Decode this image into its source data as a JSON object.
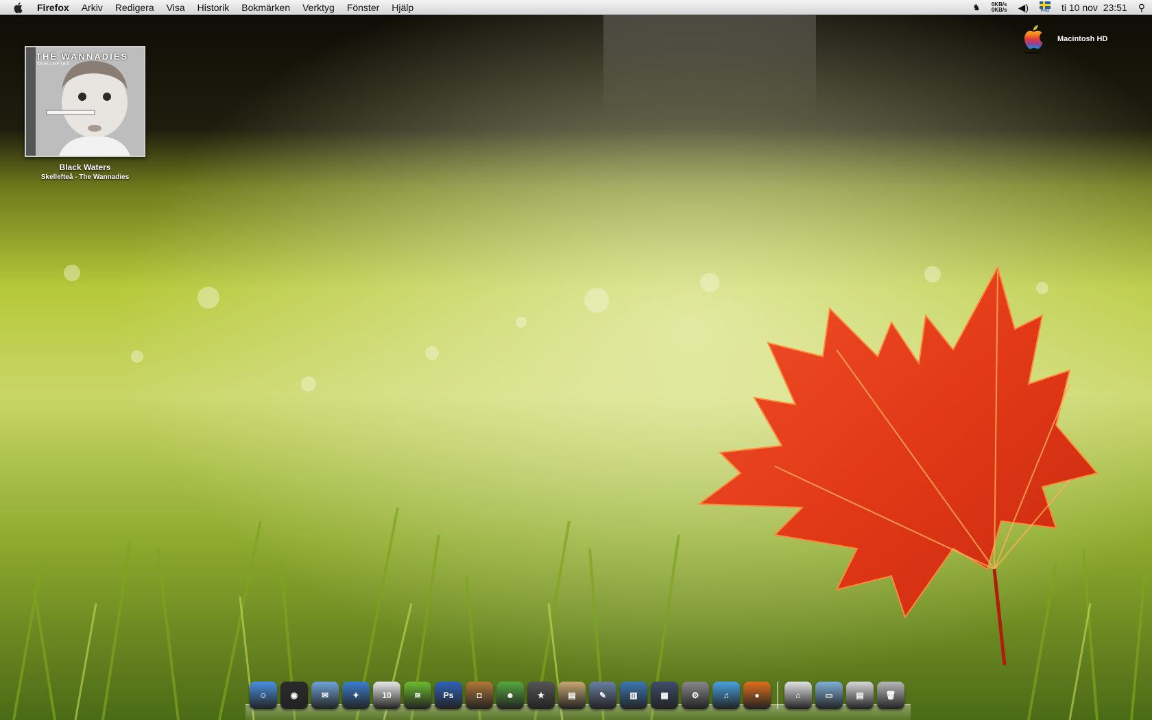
{
  "menubar": {
    "app_name": "Firefox",
    "items": [
      "Arkiv",
      "Redigera",
      "Visa",
      "Historik",
      "Bokmärken",
      "Verktyg",
      "Fönster",
      "Hjälp"
    ],
    "net_up": "0KB/s",
    "net_down": "0KB/s",
    "flag_label": "PRO",
    "datetime": "ti 10 nov  23:51"
  },
  "desktop": {
    "album": {
      "cover_title": "THE WANNADIES",
      "cover_subtitle": "SKELLEFTEÅ",
      "title": "Black Waters",
      "subtitle": "Skellefteå - The Wannadies"
    },
    "drive": {
      "label": "Macintosh HD"
    }
  },
  "dock": {
    "apps": [
      {
        "name": "finder-icon",
        "color": "#4a90e2",
        "glyph": "☺"
      },
      {
        "name": "dashboard-icon",
        "color": "#2b2b2b",
        "glyph": "◉"
      },
      {
        "name": "mail-icon",
        "color": "#6fa4d8",
        "glyph": "✉"
      },
      {
        "name": "safari-icon",
        "color": "#3a7fd0",
        "glyph": "✦"
      },
      {
        "name": "calendar-icon",
        "color": "#e9e9e9",
        "glyph": "10"
      },
      {
        "name": "spotify-icon",
        "color": "#6dbb2f",
        "glyph": "≋"
      },
      {
        "name": "photoshop-icon",
        "color": "#2f63b8",
        "glyph": "Ps"
      },
      {
        "name": "iphoto-icon",
        "color": "#b07838",
        "glyph": "◘"
      },
      {
        "name": "adium-icon",
        "color": "#56a840",
        "glyph": "☻"
      },
      {
        "name": "imovie-icon",
        "color": "#555555",
        "glyph": "★"
      },
      {
        "name": "preview-icon",
        "color": "#c7a770",
        "glyph": "▤"
      },
      {
        "name": "xcode-icon",
        "color": "#6a7fa0",
        "glyph": "✎"
      },
      {
        "name": "activity-monitor-icon",
        "color": "#3c78b4",
        "glyph": "▥"
      },
      {
        "name": "spaces-icon",
        "color": "#3d4d6a",
        "glyph": "▦"
      },
      {
        "name": "system-preferences-icon",
        "color": "#888888",
        "glyph": "⚙"
      },
      {
        "name": "itunes-icon",
        "color": "#4aa0e0",
        "glyph": "♫"
      },
      {
        "name": "firefox-icon",
        "color": "#e0701c",
        "glyph": "●"
      }
    ],
    "stacks": [
      {
        "name": "home-folder-icon",
        "color": "#e4e4e4",
        "glyph": "⌂"
      },
      {
        "name": "documents-folder-icon",
        "color": "#7fb0d8",
        "glyph": "▭"
      },
      {
        "name": "downloads-stack-icon",
        "color": "#d8d8d8",
        "glyph": "▤"
      },
      {
        "name": "trash-icon",
        "color": "#b8b8b8",
        "glyph": "🗑"
      }
    ]
  }
}
